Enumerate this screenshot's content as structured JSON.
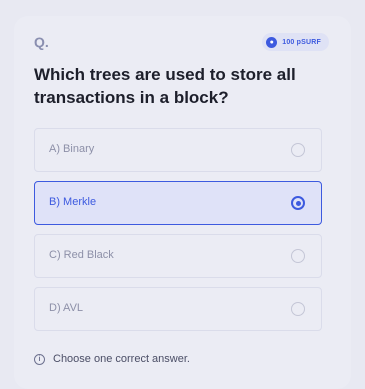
{
  "header": {
    "question_marker": "Q.",
    "reward": "100 pSURF",
    "coin_icon": "coin-icon"
  },
  "question": {
    "text": "Which trees are used to store all transactions in a block?"
  },
  "options": [
    {
      "label": "A) Binary",
      "selected": false
    },
    {
      "label": "B) Merkle",
      "selected": true
    },
    {
      "label": "C) Red Black",
      "selected": false
    },
    {
      "label": "D) AVL",
      "selected": false
    }
  ],
  "hint": {
    "icon": "info-icon",
    "text": "Choose one correct answer."
  },
  "colors": {
    "accent": "#3d5adf",
    "background": "#e8e9f2",
    "text": "#1d1f2b"
  }
}
